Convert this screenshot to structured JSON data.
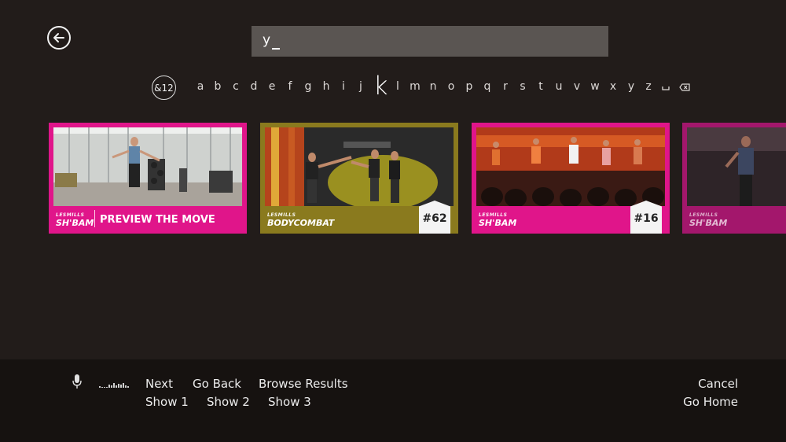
{
  "search": {
    "query": "y"
  },
  "keyboard": {
    "symbols_key": "&12",
    "keys": [
      "a",
      "b",
      "c",
      "d",
      "e",
      "f",
      "g",
      "h",
      "i",
      "j",
      "k",
      "l",
      "m",
      "n",
      "o",
      "p",
      "q",
      "r",
      "s",
      "t",
      "u",
      "v",
      "w",
      "x",
      "y",
      "z",
      "space",
      "backspace"
    ],
    "active_key": "k"
  },
  "tiles": [
    {
      "brand_small": "LESMILLS",
      "brand_big": "SH'BAM",
      "label": "PREVIEW THE MOVE",
      "badge": "",
      "color": "#e0158a"
    },
    {
      "brand_small": "LESMILLS",
      "brand_big": "BODYCOMBAT",
      "label": "",
      "badge": "#62",
      "color": "#8a7a1e"
    },
    {
      "brand_small": "LESMILLS",
      "brand_big": "SH'BAM",
      "label": "",
      "badge": "#16",
      "color": "#e0158a"
    },
    {
      "brand_small": "LESMILLS",
      "brand_big": "SH'BAM",
      "label": "",
      "badge": "",
      "color": "#a3176c"
    }
  ],
  "voice_commands": {
    "next": "Next",
    "go_back": "Go Back",
    "browse_results": "Browse Results",
    "show_1": "Show 1",
    "show_2": "Show 2",
    "show_3": "Show 3",
    "cancel": "Cancel",
    "go_home": "Go Home"
  },
  "icons": {
    "back": "back-arrow-icon",
    "mic": "microphone-icon",
    "levels": "audio-level-icon",
    "space": "space-icon",
    "backspace": "backspace-icon"
  }
}
